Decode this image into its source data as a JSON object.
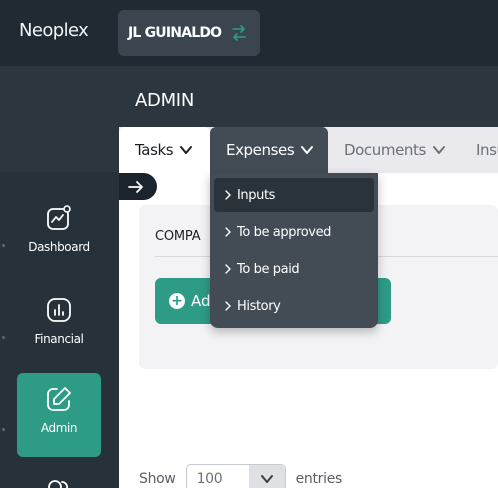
{
  "app": {
    "brand": "Neoplex"
  },
  "company_switcher": {
    "name": "JL GUINALDO",
    "icon": "swap-arrows-icon"
  },
  "sidebar": {
    "items": [
      {
        "label": "Dashboard",
        "icon": "dashboard-icon",
        "active": false
      },
      {
        "label": "Financial",
        "icon": "financial-chart-icon",
        "active": false
      },
      {
        "label": "Admin",
        "icon": "edit-icon",
        "active": true
      }
    ]
  },
  "page": {
    "title": "ADMIN"
  },
  "tabs": [
    {
      "label": "Tasks"
    },
    {
      "label": "Expenses"
    },
    {
      "label": "Documents"
    },
    {
      "label": "Insu"
    }
  ],
  "expenses_menu": {
    "items": [
      {
        "label": "Inputs"
      },
      {
        "label": "To be approved"
      },
      {
        "label": "To be paid"
      },
      {
        "label": "History"
      }
    ]
  },
  "content": {
    "company_label": "COMPA",
    "add_button_label": "Ad"
  },
  "table_controls": {
    "show_label": "Show",
    "page_size": "100",
    "entries_label": "entries"
  },
  "colors": {
    "accent": "#2e9b87",
    "topbar": "#202a33",
    "sidebar": "#273139",
    "menu": "#434c55"
  }
}
